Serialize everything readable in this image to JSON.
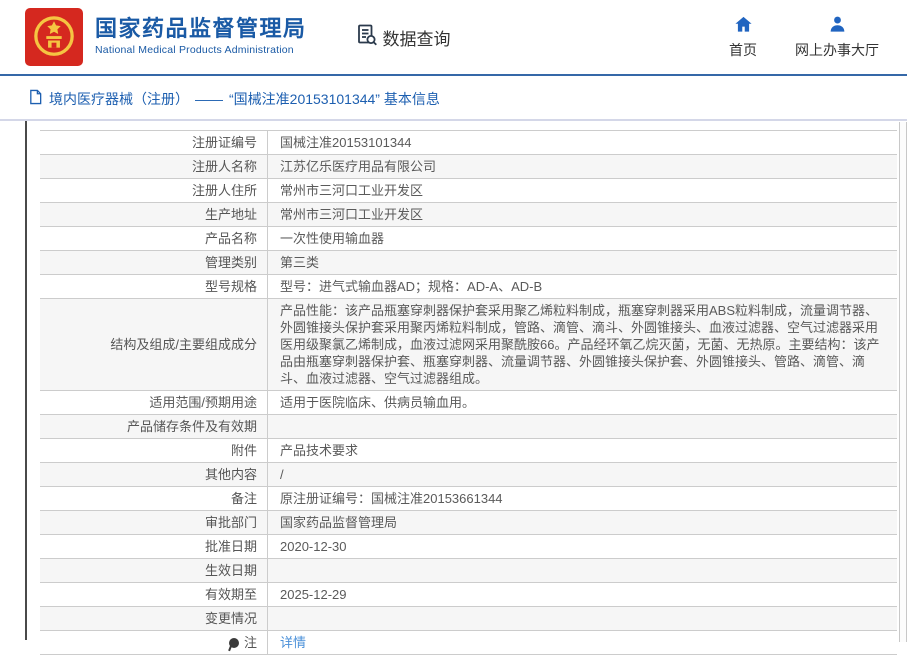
{
  "header": {
    "title_zh": "国家药品监督管理局",
    "title_en": "National Medical Products Administration",
    "data_query_label": "数据查询",
    "home_label": "首页",
    "service_hall_label": "网上办事大厅"
  },
  "breadcrumb": {
    "section_label": "境内医疗器械（注册）",
    "separator": "——",
    "current_label": "“国械注准20153101344” 基本信息"
  },
  "detail_table": {
    "rows": [
      {
        "label": "注册证编号",
        "value": "国械注准20153101344"
      },
      {
        "label": "注册人名称",
        "value": "江苏亿乐医疗用品有限公司"
      },
      {
        "label": "注册人住所",
        "value": "常州市三河口工业开发区"
      },
      {
        "label": "生产地址",
        "value": "常州市三河口工业开发区"
      },
      {
        "label": "产品名称",
        "value": "一次性使用输血器"
      },
      {
        "label": "管理类别",
        "value": "第三类"
      },
      {
        "label": "型号规格",
        "value": "型号：进气式输血器AD；规格：AD-A、AD-B"
      },
      {
        "label": "结构及组成/主要组成成分",
        "value": "产品性能：该产品瓶塞穿刺器保护套采用聚乙烯粒料制成，瓶塞穿刺器采用ABS粒料制成，流量调节器、外圆锥接头保护套采用聚丙烯粒料制成，管路、滴管、滴斗、外圆锥接头、血液过滤器、空气过滤器采用医用级聚氯乙烯制成，血液过滤网采用聚酰胺66。产品经环氧乙烷灭菌，无菌、无热原。主要结构：该产品由瓶塞穿刺器保护套、瓶塞穿刺器、流量调节器、外圆锥接头保护套、外圆锥接头、管路、滴管、滴斗、血液过滤器、空气过滤器组成。"
      },
      {
        "label": "适用范围/预期用途",
        "value": "适用于医院临床、供病员输血用。"
      },
      {
        "label": "产品储存条件及有效期",
        "value": ""
      },
      {
        "label": "附件",
        "value": "产品技术要求"
      },
      {
        "label": "其他内容",
        "value": "/"
      },
      {
        "label": "备注",
        "value": "原注册证编号：国械注准20153661344"
      },
      {
        "label": "审批部门",
        "value": "国家药品监督管理局"
      },
      {
        "label": "批准日期",
        "value": "2020-12-30"
      },
      {
        "label": "生效日期",
        "value": ""
      },
      {
        "label": "有效期至",
        "value": "2025-12-29"
      },
      {
        "label": "变更情况",
        "value": ""
      },
      {
        "label": "注",
        "value": "详情",
        "link": true,
        "note_icon": true
      }
    ]
  },
  "colors": {
    "brand_blue": "#1a5aa5",
    "logo_red": "#d5281f",
    "nav_icon_blue": "#2064c0",
    "breadcrumb_blue": "#1d5fb0",
    "link_blue": "#4a90d9",
    "header_rule": "#3568a8",
    "breadcrumb_rule": "#d4d7e8",
    "table_border": "#cccccc",
    "alt_row_bg": "#f6f6f6",
    "content_left_border": "#4a4a4a"
  }
}
